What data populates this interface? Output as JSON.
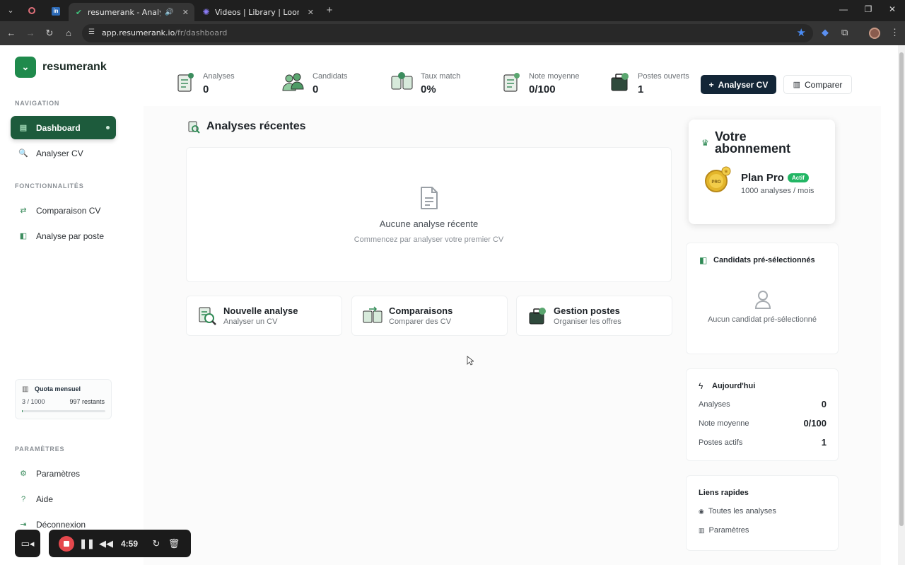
{
  "browser": {
    "tabs": [
      {
        "title": "resumerank - Analyse intell",
        "active": true
      },
      {
        "title": "Videos | Library | Loom",
        "active": false
      }
    ],
    "url_host": "app.resumerank.io",
    "url_path": "/fr/dashboard",
    "new_tab": "+"
  },
  "sidebar": {
    "brand": "resumerank",
    "sections": {
      "navigation": "NAVIGATION",
      "features": "FONCTIONNALITÉS",
      "settings": "PARAMÈTRES"
    },
    "nav": [
      {
        "label": "Dashboard",
        "icon": "dashboard-icon"
      },
      {
        "label": "Analyser CV",
        "icon": "analyze-cv-icon"
      }
    ],
    "features": [
      {
        "label": "Comparaison CV",
        "icon": "compare-icon"
      },
      {
        "label": "Analyse par poste",
        "icon": "job-analysis-icon"
      }
    ],
    "settings": [
      {
        "label": "Paramètres",
        "icon": "settings-icon"
      },
      {
        "label": "Aide",
        "icon": "help-icon"
      },
      {
        "label": "Déconnexion",
        "icon": "logout-icon"
      }
    ],
    "quota": {
      "title": "Quota mensuel",
      "used": "3 / 1000",
      "remaining": "997 restants",
      "fraction": 0.003
    }
  },
  "stats": [
    {
      "label": "Analyses",
      "value": "0"
    },
    {
      "label": "Candidats",
      "value": "0"
    },
    {
      "label": "Taux match",
      "value": "0%"
    },
    {
      "label": "Note moyenne",
      "value": "0/100"
    },
    {
      "label": "Postes ouverts",
      "value": "1"
    }
  ],
  "actions": {
    "analyze": "Analyser CV",
    "compare": "Comparer"
  },
  "recent": {
    "title": "Analyses récentes",
    "empty_title": "Aucune analyse récente",
    "empty_sub": "Commencez par analyser votre premier CV"
  },
  "quick_cards": [
    {
      "title": "Nouvelle analyse",
      "sub": "Analyser un CV"
    },
    {
      "title": "Comparaisons",
      "sub": "Comparer des CV"
    },
    {
      "title": "Gestion postes",
      "sub": "Organiser les offres"
    }
  ],
  "subscription": {
    "title": "Votre abonnement",
    "plan": "Plan Pro",
    "badge": "Actif",
    "detail": "1000 analyses / mois",
    "medal_text": "PRO"
  },
  "shortlist": {
    "title": "Candidats pré-sélectionnés",
    "empty": "Aucun candidat pré-sélectionné"
  },
  "today": {
    "title": "Aujourd'hui",
    "rows": [
      {
        "label": "Analyses",
        "value": "0"
      },
      {
        "label": "Note moyenne",
        "value": "0/100"
      },
      {
        "label": "Postes actifs",
        "value": "1"
      }
    ]
  },
  "links": {
    "title": "Liens rapides",
    "items": [
      "Toutes les analyses",
      "Paramètres"
    ]
  },
  "loom": {
    "timer": "4:59"
  },
  "colors": {
    "accent": "#1d5b3c",
    "dark_button": "#132637",
    "badge": "#22b664"
  }
}
